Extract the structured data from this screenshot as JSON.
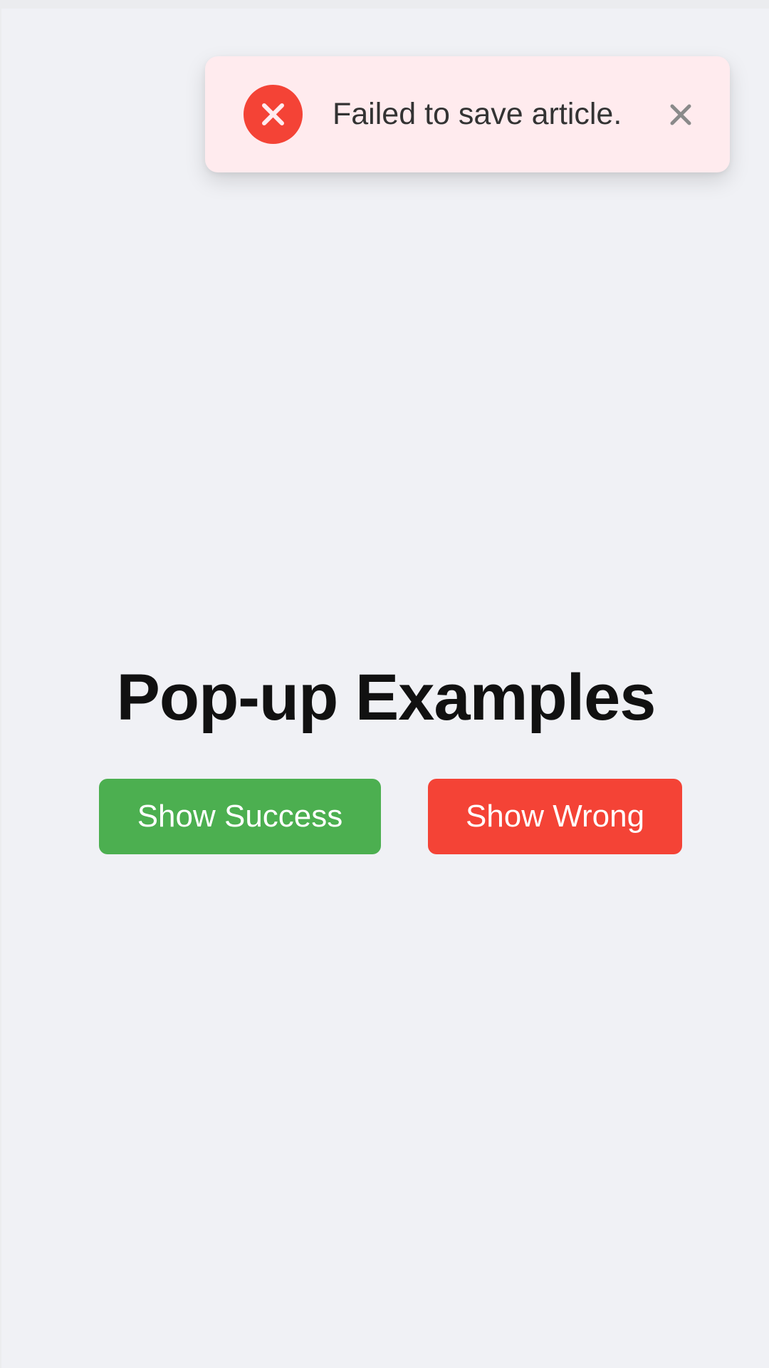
{
  "toast": {
    "message": "Failed to save article.",
    "type": "error",
    "icon": "error-x-icon",
    "close_icon": "close-icon",
    "colors": {
      "background": "#ffebee",
      "icon_circle": "#f44336",
      "text": "#333333",
      "close": "#8a8a8a"
    }
  },
  "page": {
    "title": "Pop-up Examples"
  },
  "buttons": {
    "success": {
      "label": "Show Success",
      "color": "#4caf50"
    },
    "wrong": {
      "label": "Show Wrong",
      "color": "#f44336"
    }
  }
}
